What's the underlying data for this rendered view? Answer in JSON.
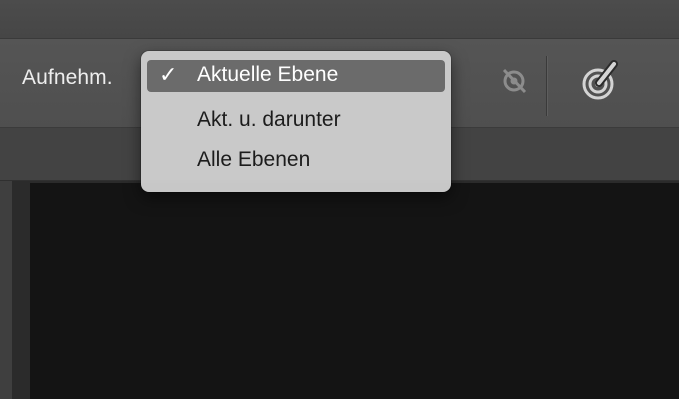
{
  "options_bar": {
    "sample_label": "Aufnehm.",
    "sample_icon": "ignore-adjustment-layers-icon",
    "brush_icon": "pressure-brush-icon"
  },
  "sample_menu": {
    "items": [
      {
        "label": "Aktuelle Ebene",
        "checked": true,
        "check_mark": "✓"
      },
      {
        "label": "Akt. u. darunter",
        "checked": false
      },
      {
        "label": "Alle Ebenen",
        "checked": false
      }
    ]
  }
}
